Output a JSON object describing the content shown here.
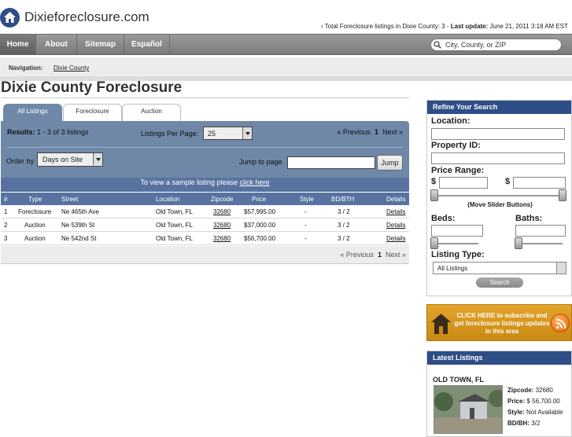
{
  "header": {
    "site_name": "Dixieforeclosure.com",
    "stats_prefix": "› Total Foreclosure listings in Dixie County: 3 - ",
    "stats_update_label": "Last update:",
    "stats_update_value": " June 21, 2011 3:18 AM EST"
  },
  "nav": {
    "items": [
      "Home",
      "About",
      "Sitemap",
      "Español"
    ],
    "search_placeholder": "City, County, or ZIP"
  },
  "breadcrumb": {
    "label": "Navigation:",
    "link": "Dixie County"
  },
  "page_title": "Dixie County Foreclosure",
  "tabs": [
    "All Listings",
    "Foreclosure",
    "Auction"
  ],
  "results": {
    "label": "Results:",
    "text": " 1 - 3 of 3 listings",
    "per_page_label": "Listings Per Page:",
    "per_page_value": "25",
    "pager_prev": "« Previous",
    "pager_current": "1",
    "pager_next": "Next »",
    "order_label": "Order by",
    "order_value": "Days on Site",
    "jump_label": "Jump to page",
    "jump_button": "Jump"
  },
  "sample_bar": {
    "text": "To view a sample listing please ",
    "link": "click here"
  },
  "table": {
    "headers": [
      "#",
      "Type",
      "Street",
      "Location",
      "Zipcode",
      "Price",
      "Style",
      "BD/BTH",
      "Details"
    ],
    "rows": [
      [
        "1",
        "Foreclosure",
        "Ne 465th Ave",
        "Old Town, FL",
        "32680",
        "$57,995.00",
        "-",
        "3 / 2",
        "Details"
      ],
      [
        "2",
        "Auction",
        "Ne 539th St",
        "Old Town, FL",
        "32680",
        "$37,000.00",
        "-",
        "3 / 2",
        "Details"
      ],
      [
        "3",
        "Auction",
        "Ne 542nd St",
        "Old Town, FL",
        "32680",
        "$56,700.00",
        "-",
        "3 / 2",
        "Details"
      ]
    ]
  },
  "pager_bottom": {
    "prev": "« Previous",
    "current": "1",
    "next": "Next »"
  },
  "refine": {
    "title": "Refine Your Search",
    "location_label": "Location:",
    "property_id_label": "Property ID:",
    "price_label": "Price Range:",
    "currency": "$",
    "slider_note": "(Move Slider Buttons)",
    "beds_label": "Beds:",
    "baths_label": "Baths:",
    "listing_type_label": "Listing Type:",
    "listing_type_value": "All Listings",
    "search_button": "Search"
  },
  "subscribe": {
    "text": "CLICK HERE to subscribe and get foreclosure listings updates in this area"
  },
  "latest": {
    "title": "Latest Listings",
    "city": "OLD TOWN, FL",
    "zip_label": "Zipcode:",
    "zip_value": " 32680",
    "price_label": "Price:",
    "price_value": " $ 56,700.00",
    "style_label": "Style:",
    "style_value": " Not Available",
    "bdbh_label": "BD/BH:",
    "bdbh_value": " 3/2"
  },
  "colors": {
    "brand_blue": "#2d4e86",
    "panel_blue": "#6f88a8",
    "subscribe_orange": "#e5a52c"
  }
}
